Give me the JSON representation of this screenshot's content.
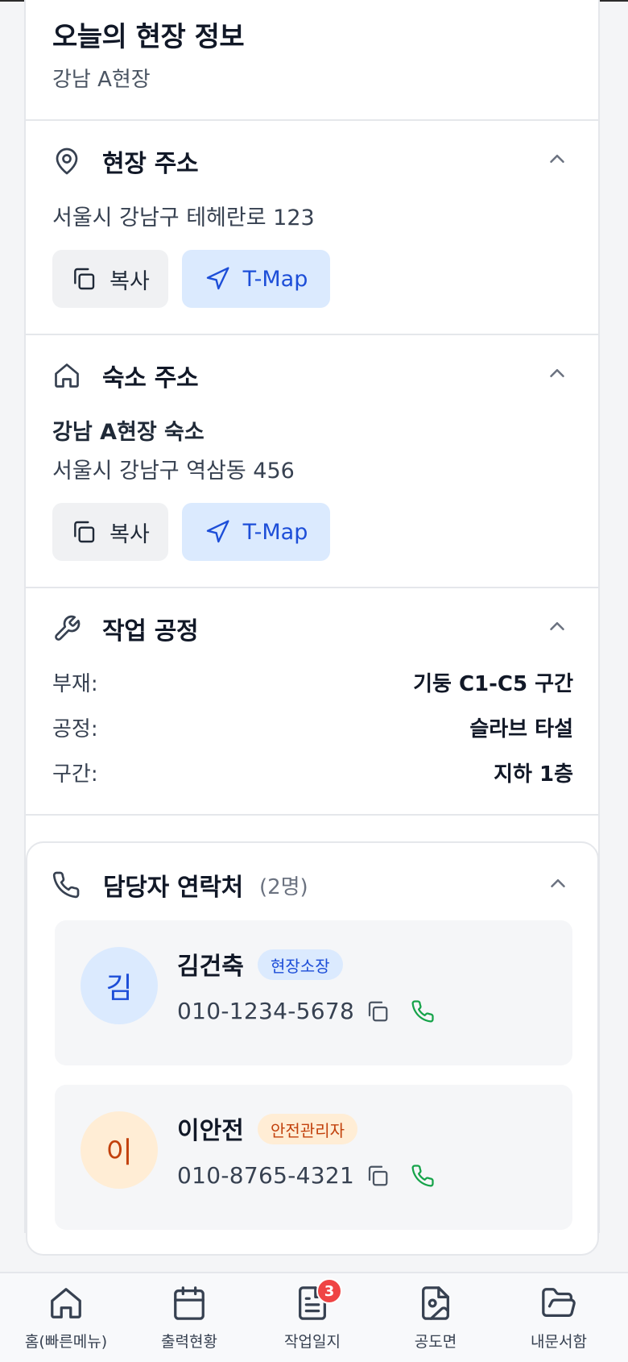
{
  "header": {
    "title": "오늘의 현장 정보",
    "site_name": "강남 A현장"
  },
  "site_address": {
    "title": "현장 주소",
    "address": "서울시 강남구 테헤란로 123",
    "copy_label": "복사",
    "map_label": "T-Map"
  },
  "lodging_address": {
    "title": "숙소 주소",
    "name": "강남 A현장 숙소",
    "address": "서울시 강남구 역삼동 456",
    "copy_label": "복사",
    "map_label": "T-Map"
  },
  "work_process": {
    "title": "작업 공정",
    "rows": [
      {
        "key": "부재:",
        "value": "기둥 C1-C5 구간"
      },
      {
        "key": "공정:",
        "value": "슬라브 타설"
      },
      {
        "key": "구간:",
        "value": "지하 1층"
      }
    ]
  },
  "contacts": {
    "title": "담당자 연락처",
    "count": "(2명)",
    "people": [
      {
        "initial": "김",
        "name": "김건축",
        "role": "현장소장",
        "phone": "010-1234-5678"
      },
      {
        "initial": "이",
        "name": "이안전",
        "role": "안전관리자",
        "phone": "010-8765-4321"
      }
    ]
  },
  "bottom_nav": {
    "items": [
      {
        "label": "홈(빠른메뉴)"
      },
      {
        "label": "출력현황"
      },
      {
        "label": "작업일지",
        "badge": "3"
      },
      {
        "label": "공도면"
      },
      {
        "label": "내문서함"
      }
    ]
  },
  "colors": {
    "accent_blue": "#1d4ed8",
    "map_button_bg": "#dbeafe",
    "call_green": "#16a34a",
    "badge_red": "#ef4444",
    "manager_badge_bg": "#dbeafe",
    "safety_badge_bg": "#ffedd5"
  }
}
